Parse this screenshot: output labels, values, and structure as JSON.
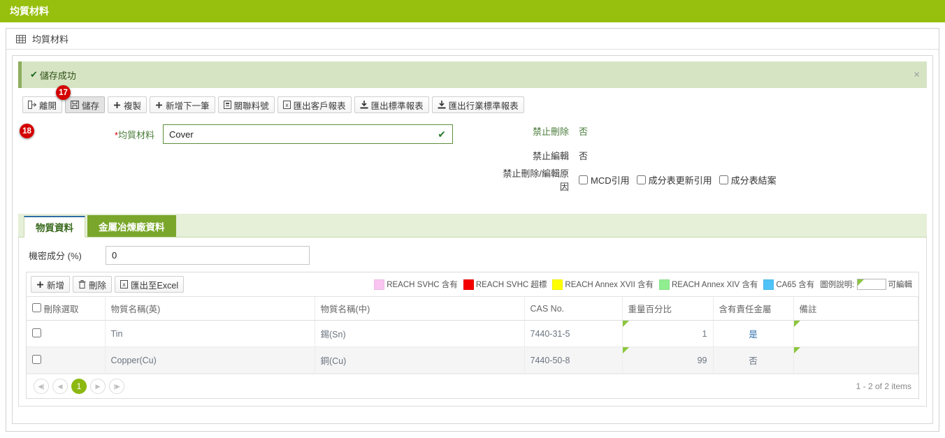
{
  "window": {
    "title": "均質材料"
  },
  "breadcrumb": {
    "icon": "grid-icon",
    "label": "均質材料"
  },
  "alert": {
    "icon": "check-icon",
    "message": "儲存成功",
    "close_label": "×"
  },
  "toolbar": {
    "buttons": [
      {
        "label": "離開",
        "icon": "exit-icon",
        "pressed": false
      },
      {
        "label": "儲存",
        "icon": "save-disk-icon",
        "pressed": true
      },
      {
        "label": "複製",
        "icon": "plus-icon",
        "pressed": false
      },
      {
        "label": "新增下一筆",
        "icon": "plus-icon",
        "pressed": false
      },
      {
        "label": "關聯料號",
        "icon": "document-icon",
        "pressed": false
      },
      {
        "label": "匯出客戶報表",
        "icon": "excel-icon",
        "pressed": false
      },
      {
        "label": "匯出標準報表",
        "icon": "download-icon",
        "pressed": false
      },
      {
        "label": "匯出行業標準報表",
        "icon": "download-icon",
        "pressed": false
      }
    ]
  },
  "markers": [
    {
      "id": "17",
      "target": "儲存"
    },
    {
      "id": "18",
      "target": "均質材料"
    }
  ],
  "form": {
    "material": {
      "label": "均質材料",
      "required": "*",
      "value": "Cover",
      "valid_icon": "check-icon"
    },
    "no_delete": {
      "label": "禁止刪除",
      "value": "否"
    },
    "no_edit": {
      "label": "禁止編輯",
      "value": "否"
    },
    "reason": {
      "label": "禁止刪除/編輯原因",
      "options": [
        {
          "label": "MCD引用",
          "checked": false
        },
        {
          "label": "成分表更新引用",
          "checked": false
        },
        {
          "label": "成分表結案",
          "checked": false
        }
      ]
    }
  },
  "tabs": [
    {
      "label": "物質資料",
      "active": true
    },
    {
      "label": "金屬冶煉廠資料",
      "active": false
    }
  ],
  "panel": {
    "confidential": {
      "label": "機密成分 (%)",
      "value": "0"
    }
  },
  "grid_toolbar": {
    "buttons": [
      {
        "label": "新增",
        "icon": "plus-icon"
      },
      {
        "label": "刪除",
        "icon": "trash-icon"
      },
      {
        "label": "匯出至Excel",
        "icon": "excel-icon"
      }
    ],
    "legend": [
      {
        "label": "REACH SVHC 含有",
        "color": "#f9c6f0"
      },
      {
        "label": "REACH SVHC 超標",
        "color": "#f40000"
      },
      {
        "label": "REACH Annex XVII 含有",
        "color": "#ffff00"
      },
      {
        "label": "REACH Annex XIV 含有",
        "color": "#90ee90"
      },
      {
        "label": "CA65 含有",
        "color": "#4fc3f7"
      }
    ],
    "legend_note_label": "圖例說明:",
    "legend_note_value": "可編輯",
    "editable_marker_color": "#8cc63e"
  },
  "grid": {
    "columns": [
      "刪除選取",
      "物質名稱(英)",
      "物質名稱(中)",
      "CAS No.",
      "重量百分比",
      "含有責任金屬",
      "備註"
    ],
    "select_all_checked": false,
    "rows": [
      {
        "selected": false,
        "name_en": "Tin",
        "name_cn": "錫(Sn)",
        "cas": "7440-31-5",
        "weight_pct": "1",
        "metal": "是",
        "metal_is_link": true,
        "remark": ""
      },
      {
        "selected": false,
        "name_en": "Copper(Cu)",
        "name_cn": "銅(Cu)",
        "cas": "7440-50-8",
        "weight_pct": "99",
        "metal": "否",
        "metal_is_link": false,
        "remark": ""
      }
    ]
  },
  "pager": {
    "first": "first-page-icon",
    "prev": "prev-page-icon",
    "current_page": "1",
    "next": "next-page-icon",
    "last": "last-page-icon",
    "info": "1 - 2 of 2 items"
  },
  "colors": {
    "brand_green": "#97bf0d",
    "tab_green": "#7aa72b",
    "alert_bg": "#d6e4c4",
    "pager_active": "#8cb811"
  }
}
